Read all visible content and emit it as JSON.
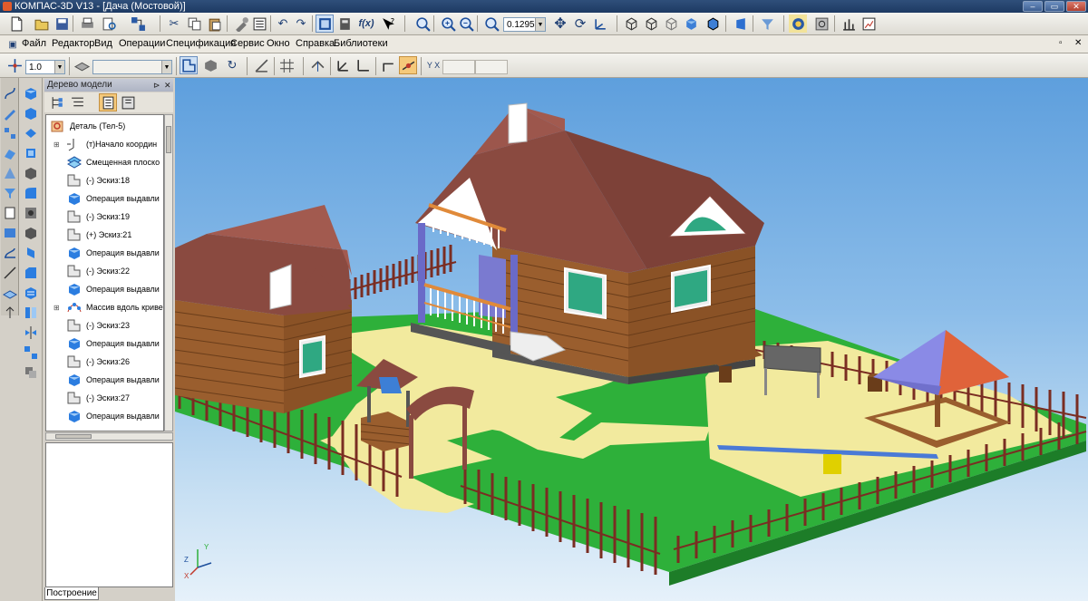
{
  "window": {
    "title": "КОМПАС-3D V13 - [Дача (Мостовой)]"
  },
  "menu": {
    "items": [
      "Файл",
      "Редактор",
      "Вид",
      "Операции",
      "Спецификация",
      "Сервис",
      "Окно",
      "Справка",
      "Библиотеки"
    ]
  },
  "toolbar": {
    "zoom_value": "0.1295",
    "step_value": "1.0",
    "function_label": "f(x)"
  },
  "tree": {
    "title": "Дерево модели",
    "tab_label": "Построение",
    "items": [
      {
        "label": "Деталь (Тел-5)",
        "icon": "part-icon"
      },
      {
        "label": "(т)Начало координ",
        "icon": "origin-icon"
      },
      {
        "label": "Смещенная плоско",
        "icon": "plane-icon"
      },
      {
        "label": "(-) Эскиз:18",
        "icon": "sketch-icon"
      },
      {
        "label": "Операция выдавли",
        "icon": "extrude-icon"
      },
      {
        "label": "(-) Эскиз:19",
        "icon": "sketch-icon"
      },
      {
        "label": "(+) Эскиз:21",
        "icon": "sketch-icon"
      },
      {
        "label": "Операция выдавли",
        "icon": "extrude-icon"
      },
      {
        "label": "(-) Эскиз:22",
        "icon": "sketch-icon"
      },
      {
        "label": "Операция выдавли",
        "icon": "extrude-icon"
      },
      {
        "label": "Массив вдоль криве",
        "icon": "pattern-icon"
      },
      {
        "label": "(-) Эскиз:23",
        "icon": "sketch-icon"
      },
      {
        "label": "Операция выдавли",
        "icon": "extrude-icon"
      },
      {
        "label": "(-) Эскиз:26",
        "icon": "sketch-icon"
      },
      {
        "label": "Операция выдавли",
        "icon": "extrude-icon"
      },
      {
        "label": "(-) Эскиз:27",
        "icon": "sketch-icon"
      },
      {
        "label": "Операция выдавли",
        "icon": "extrude-icon"
      }
    ]
  },
  "axes": {
    "x": "X",
    "y": "Y",
    "z": "Z"
  },
  "colors": {
    "grass": "#2eb03a",
    "sand": "#f2ea9e",
    "roof": "#8a4a40",
    "log": "#9a5e2e",
    "fence": "#7a2d22",
    "sky": "#6aa8e0"
  }
}
